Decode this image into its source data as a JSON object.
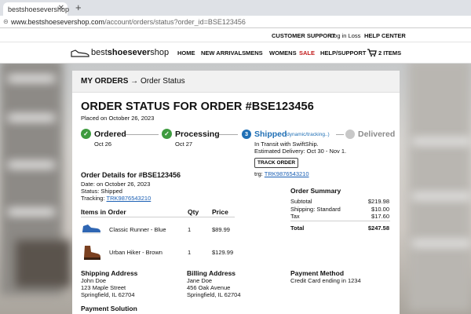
{
  "browser": {
    "tab_title": "bestshoesevershop",
    "url_host": "www.bestshoesevershop.com",
    "url_path": "/account/orders/status?order_id=BSE123456"
  },
  "topnav": {
    "customer_support": "CUSTOMER SUPPORT",
    "login": "Log in Loss",
    "help_center": "HELP CENTER"
  },
  "brand": {
    "part1": "best",
    "part2": "shoesever",
    "part3": "shop"
  },
  "nav": {
    "home": "HOME",
    "new_arrivals": "NEW ARRIVALS",
    "mens": "MENS",
    "womens": "WOMENS",
    "sale": "SALE",
    "help_support": "HELP/SUPPORT",
    "cart": "2 ITEMS"
  },
  "breadcrumb": {
    "root": "MY ORDERS",
    "arrow": "→",
    "current": "Order Status"
  },
  "order": {
    "heading": "ORDER STATUS FOR ORDER #BSE123456",
    "placed": "Placed on October 26, 2023"
  },
  "steps": {
    "ordered": {
      "title": "Ordered",
      "date": "Oct 26"
    },
    "processing": {
      "title": "Processing",
      "date": "Oct 27"
    },
    "shipped": {
      "number": "3",
      "title": "Shipped",
      "tag": "(dynamic/tracking..)",
      "line1": "In Transit with SwiftShip.",
      "line2": "Estimated Delivery: Oct 30 - Nov 1.",
      "button": "TRACK ORDER",
      "trg_label": "trg:",
      "trg_number": "TRK9876543210"
    },
    "delivered": {
      "title": "Delivered"
    }
  },
  "details": {
    "heading": "Order Details for #BSE123456",
    "date": "Date: on October 26, 2023",
    "status": "Status: Shipped",
    "tracking_label": "Tracking:",
    "tracking_number": "TRK9876543210"
  },
  "items": {
    "headers": {
      "item": "Items in Order",
      "qty": "Qty",
      "price": "Price"
    },
    "rows": [
      {
        "name": "Classic Runner - Blue",
        "qty": "1",
        "price": "$89.99",
        "color": "#2f66b3"
      },
      {
        "name": "Urban Hiker - Brown",
        "qty": "1",
        "price": "$129.99",
        "color": "#7a4020"
      }
    ]
  },
  "summary": {
    "heading": "Order Summary",
    "subtotal_label": "Subtotal",
    "subtotal": "$219.98",
    "shipping_label": "Shipping: Standard",
    "shipping": "$10.00",
    "tax_label": "Tax",
    "tax": "$17.60",
    "total_label": "Total",
    "total": "$247.58"
  },
  "shipping_address": {
    "heading": "Shipping Address",
    "name": "John Doe",
    "street": "123 Maple Street",
    "city": "Springfield, IL 62704"
  },
  "billing_address": {
    "heading": "Billing Address",
    "name": "Jane Doe",
    "street": "456 Oak Avenue",
    "city": "Springfield, IL 62704"
  },
  "payment": {
    "heading": "Payment Method",
    "text": "Credit Card ending in 1234"
  },
  "payment_solution": {
    "heading": "Payment Solution"
  },
  "colors": {
    "accent": "#1f6fb5",
    "success": "#3e9b3f",
    "sale": "#c21b1b"
  }
}
